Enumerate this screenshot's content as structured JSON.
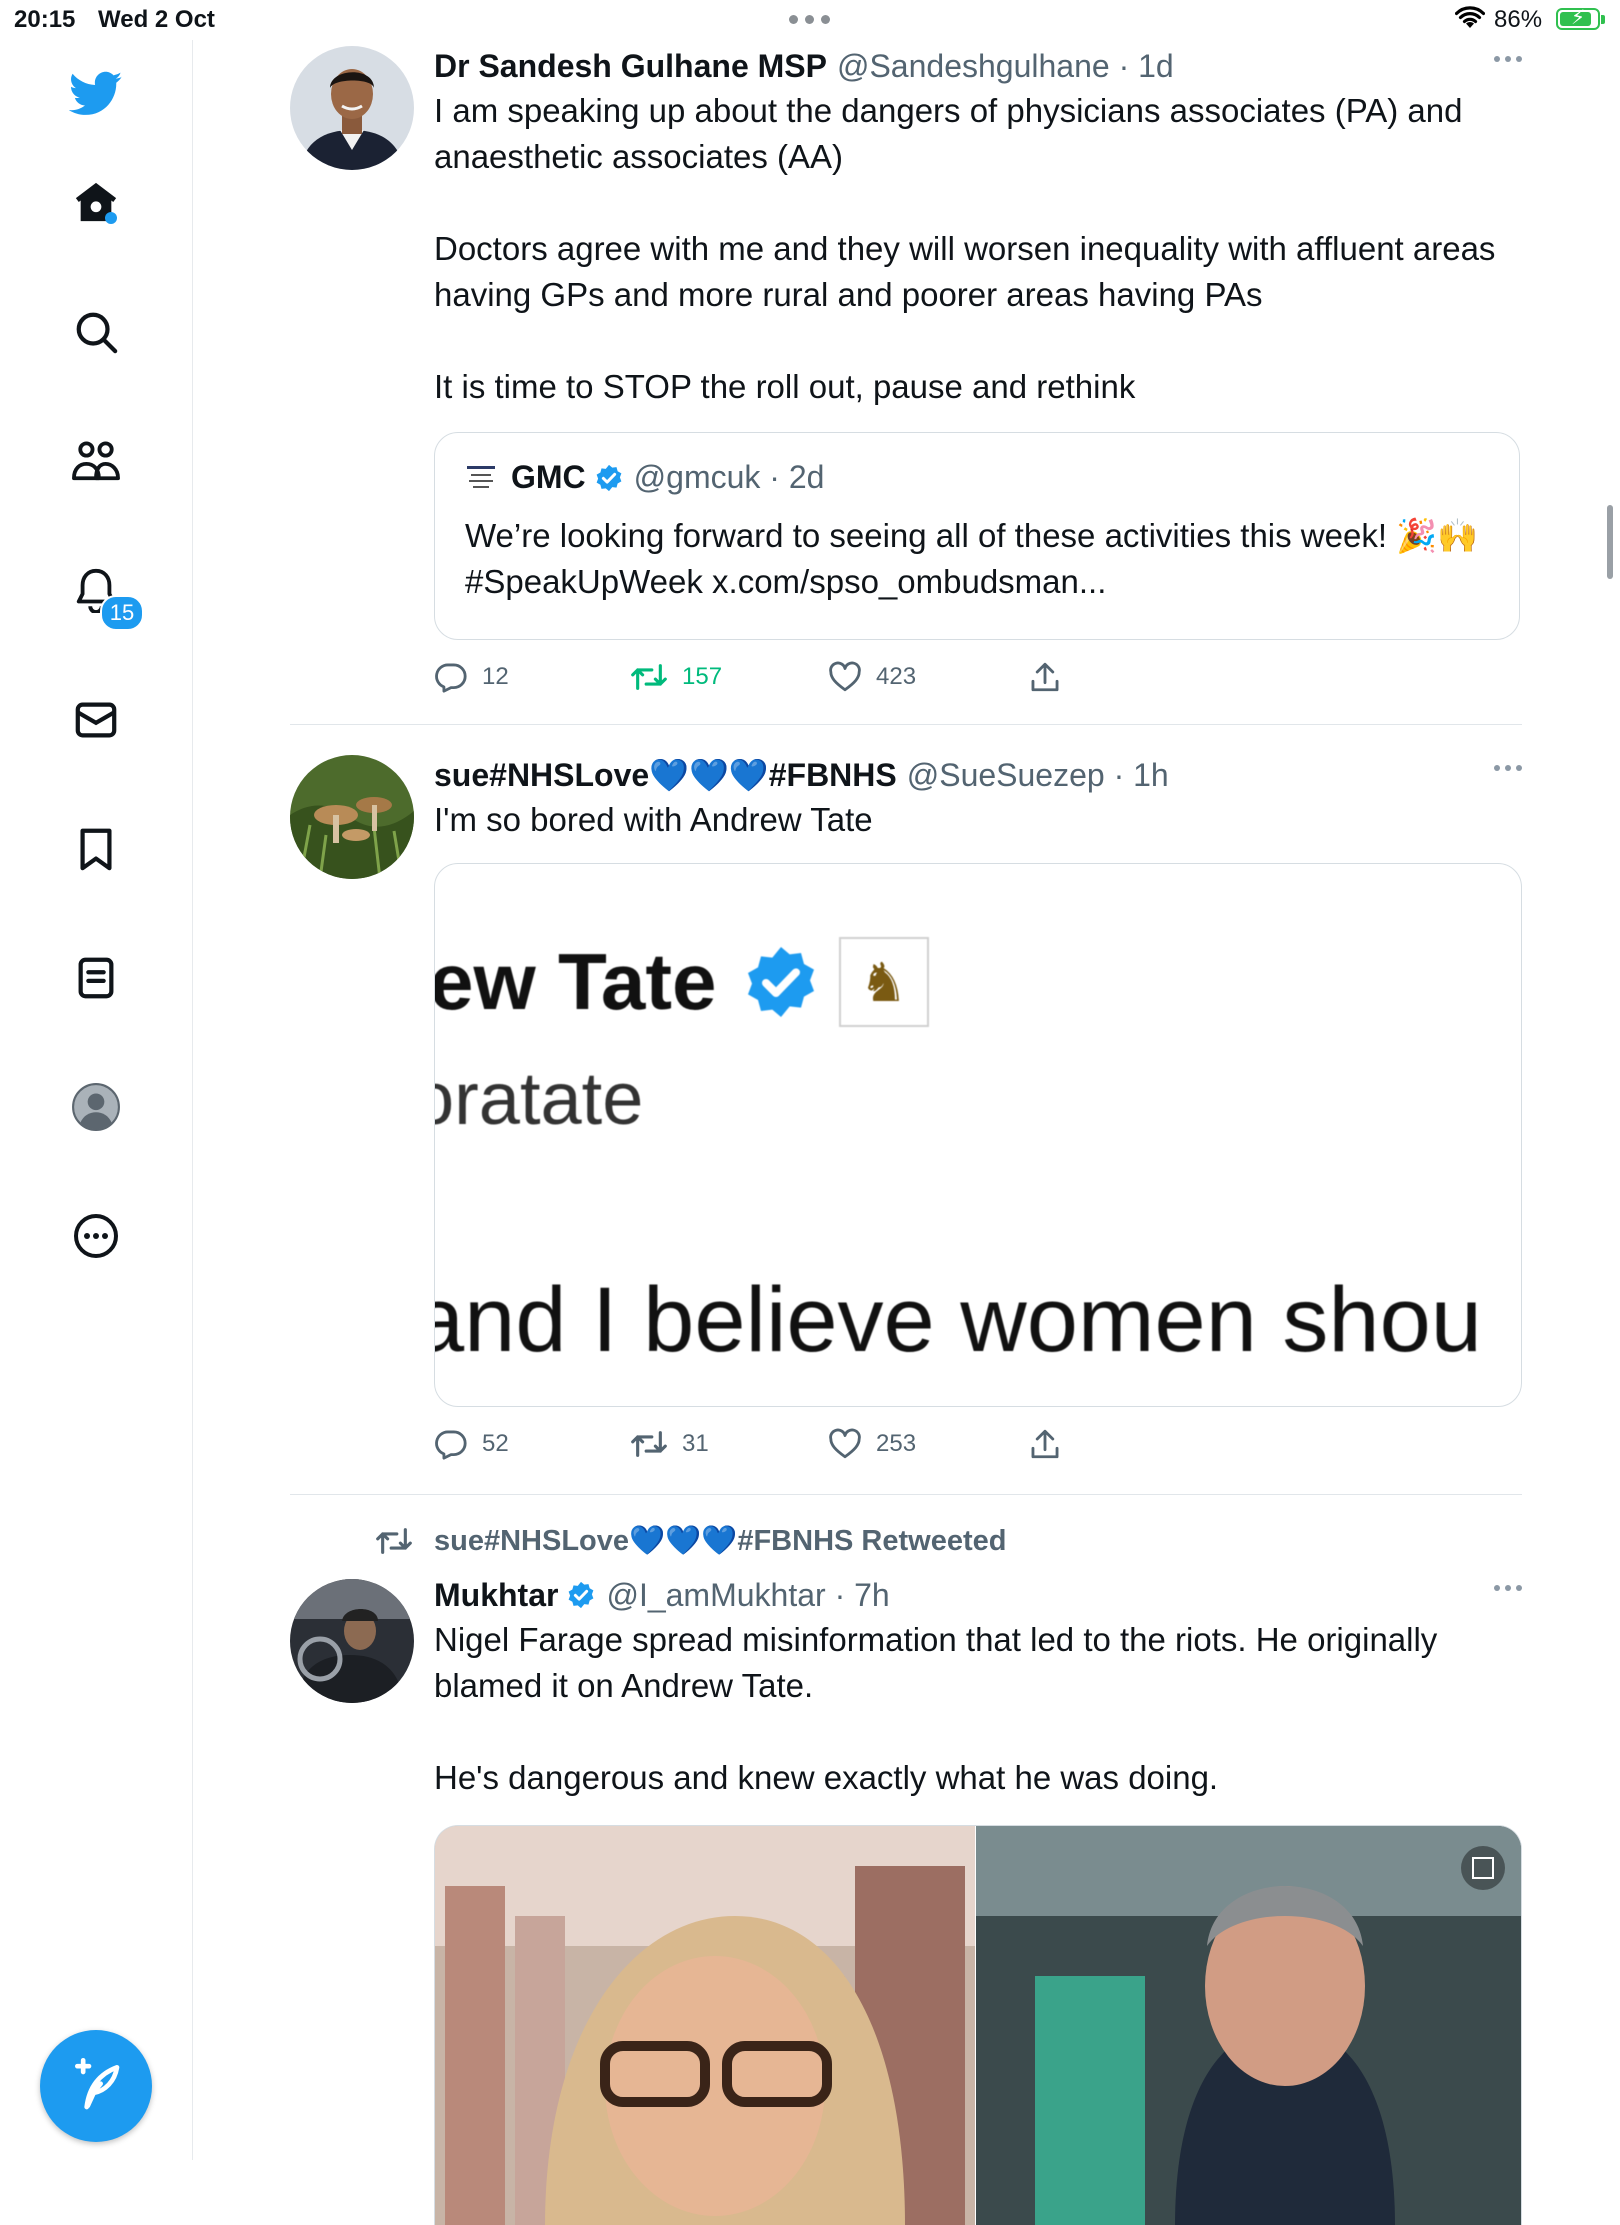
{
  "status_bar": {
    "time": "20:15",
    "date": "Wed 2 Oct",
    "battery": "86%",
    "battery_level": 0.86
  },
  "sidebar": {
    "notifications_badge": "15",
    "items": [
      {
        "name": "twitter-logo-icon"
      },
      {
        "name": "home-icon"
      },
      {
        "name": "search-icon"
      },
      {
        "name": "communities-icon"
      },
      {
        "name": "notifications-icon"
      },
      {
        "name": "messages-icon"
      },
      {
        "name": "bookmarks-icon"
      },
      {
        "name": "lists-icon"
      },
      {
        "name": "profile-icon"
      },
      {
        "name": "more-icon"
      }
    ],
    "compose": "compose-tweet-icon"
  },
  "colors": {
    "accent": "#1d9bf0",
    "retweet_active": "#00ba7c",
    "muted": "#536471"
  },
  "tweets": [
    {
      "name": "Dr Sandesh Gulhane MSP",
      "handle": "@Sandeshgulhane · 1d",
      "text": "I am speaking up about the dangers of physicians associates (PA) and anaesthetic associates (AA)\n\nDoctors agree with me and they will worsen inequality with affluent areas having GPs and more rural and poorer areas having PAs\n\nIt is time to STOP the roll out, pause and rethink",
      "quote": {
        "logo_text": "General Medical Council",
        "name": "GMC",
        "handle": "@gmcuk · 2d",
        "text": "We’re looking forward to seeing all of these activities this week! 🎉🙌 #SpeakUpWeek x.com/spso_ombudsman..."
      },
      "replies": "12",
      "retweets": "157",
      "likes": "423"
    },
    {
      "name": "sue#NHSLove💙💙💙#FBNHS",
      "handle": "@SueSuezep · 1h",
      "text": "I'm so bored with Andrew Tate",
      "media_lines": [
        "ew Tate",
        "oratate",
        "and I believe women shou"
      ],
      "replies": "52",
      "retweets": "31",
      "likes": "253"
    },
    {
      "retweeted_by": "sue#NHSLove💙💙💙#FBNHS Retweeted",
      "name": "Mukhtar",
      "handle": "@I_amMukhtar · 7h",
      "text": "Nigel Farage spread misinformation that led to the riots. He originally blamed it on Andrew Tate.\n\nHe's dangerous and knew exactly what he was doing."
    }
  ]
}
